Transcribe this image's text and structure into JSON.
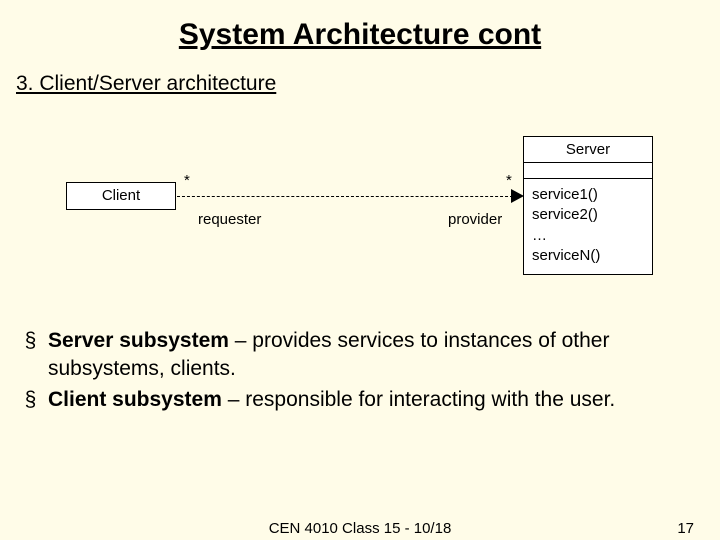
{
  "title": "System Architecture cont",
  "subtitle": "3. Client/Server architecture",
  "diagram": {
    "client_label": "Client",
    "server_title": "Server",
    "server_ops": {
      "op1": "service1()",
      "op2": "service2()",
      "dots": "…",
      "opN": "serviceN()"
    },
    "mult_left": "*",
    "mult_right": "*",
    "role_left": "requester",
    "role_right": "provider"
  },
  "bullets": {
    "b1_bold": "Server subsystem",
    "b1_rest": " – provides services to instances of other subsystems, clients.",
    "b2_bold": "Client subsystem",
    "b2_rest": " – responsible for interacting with the user."
  },
  "footer": {
    "center": "CEN 4010 Class 15 - 10/18",
    "page": "17"
  }
}
